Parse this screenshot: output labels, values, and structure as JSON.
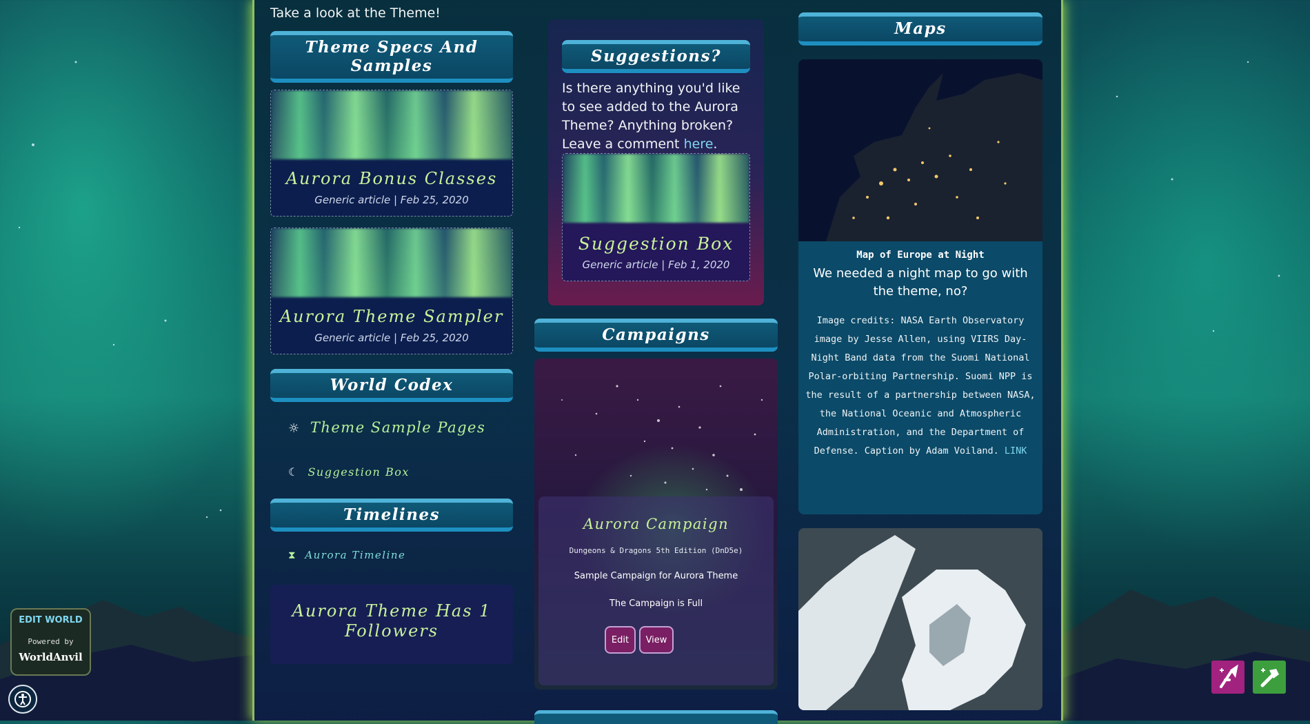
{
  "intro_text": "Take a look at the Theme!",
  "left": {
    "theme_specs_banner": "Theme Specs And Samples",
    "articles": [
      {
        "title": "Aurora Bonus Classes",
        "meta": "Generic article | Feb 25, 2020"
      },
      {
        "title": "Aurora Theme Sampler",
        "meta": "Generic article | Feb 25, 2020"
      }
    ],
    "world_codex_banner": "World Codex",
    "codex_items": [
      {
        "icon": "sun-icon",
        "glyph": "☼",
        "label": "Theme Sample Pages"
      },
      {
        "icon": "moon-icon",
        "glyph": "☾",
        "label": "Suggestion Box"
      }
    ],
    "timelines_banner": "Timelines",
    "timeline_items": [
      {
        "icon": "hourglass-icon",
        "glyph": "⧗",
        "label": "Aurora Timeline"
      }
    ],
    "followers_text": "Aurora Theme Has 1 Followers"
  },
  "middle": {
    "suggestions_banner": "Suggestions?",
    "suggestions_text_before": "Is there anything you'd like to see added to the Aurora Theme? Anything broken? Leave a comment ",
    "suggestions_link": "here",
    "suggestions_text_after": ".",
    "suggestion_article": {
      "title": "Suggestion Box",
      "meta": "Generic article | Feb 1, 2020"
    },
    "campaigns_banner": "Campaigns",
    "campaign": {
      "title": "Aurora Campaign",
      "system": "Dungeons & Dragons 5th Edition (DnD5e)",
      "description": "Sample Campaign for Aurora Theme",
      "status": "The Campaign is Full",
      "edit_label": "Edit",
      "view_label": "View"
    }
  },
  "right": {
    "maps_banner": "Maps",
    "map_title": "Map of Europe at Night",
    "map_caption": "We needed a night map to go with the theme, no?",
    "credits_text": "Image credits: NASA Earth Observatory image by Jesse Allen, using VIIRS Day-Night Band data from the Suomi National Polar-orbiting Partnership. Suomi NPP is the result of a partnership between NASA, the National Oceanic and Atmospheric Administration, and the Department of Defense. Caption by Adam Voiland.",
    "credits_link": "LINK"
  },
  "widgets": {
    "edit_world": "EDIT WORLD",
    "powered_by": "Powered by",
    "worldanvil": "WorldAnvil"
  },
  "colors": {
    "accent_green": "#c8f29a",
    "link_blue": "#7fd6f0",
    "banner_blue": "#0f5a78",
    "button_purple": "#7a1f63"
  }
}
